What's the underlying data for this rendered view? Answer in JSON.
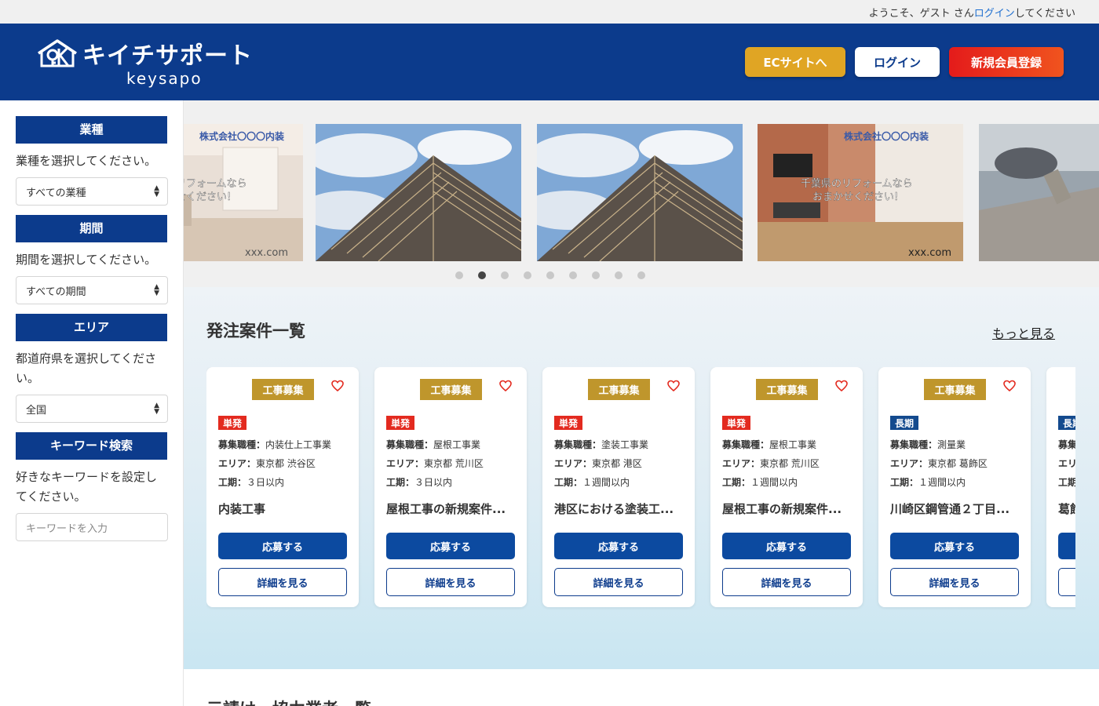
{
  "topbar": {
    "welcome_prefix": "ようこそ、ゲスト さん",
    "login_link": "ログイン",
    "welcome_suffix": "してください"
  },
  "header": {
    "logo_text": "キイチサポート",
    "logo_sub": "keysapo",
    "ec_button": "ECサイトへ",
    "login_button": "ログイン",
    "register_button": "新規会員登録"
  },
  "sidebar": {
    "industry_head": "業種",
    "industry_text": "業種を選択してください。",
    "industry_select": "すべての業種",
    "period_head": "期間",
    "period_text": "期間を選択してください。",
    "period_select": "すべての期間",
    "area_head": "エリア",
    "area_text": "都道府県を選択してください。",
    "area_select": "全国",
    "keyword_head": "キーワード検索",
    "keyword_text": "好きなキーワードを設定してください。",
    "keyword_placeholder": "キーワードを入力"
  },
  "carousel": {
    "banner_company": "株式会社〇〇〇内装",
    "banner_left_line1": "リフォームなら",
    "banner_left_line2": "せください!",
    "banner_line1": "千葉県のリフォームなら",
    "banner_line2": "おまかせください!",
    "banner_url": "xxx.com",
    "active_index": 1,
    "dot_count": 9
  },
  "section": {
    "title": "発注案件一覧",
    "more_link": "もっと見る",
    "next_title": "元請け・協力業者一覧"
  },
  "labels": {
    "recruit_badge": "工事募集",
    "job_type": "募集職種",
    "area": "エリア",
    "period": "工期",
    "apply": "応募する",
    "detail": "詳細を見る"
  },
  "cards": [
    {
      "tag": "単発",
      "job": "内装仕上工事業",
      "area": "東京都 渋谷区",
      "period": "３日以内",
      "title": "内装工事"
    },
    {
      "tag": "単発",
      "job": "屋根工事業",
      "area": "東京都 荒川区",
      "period": "３日以内",
      "title": "屋根工事の新規案件..."
    },
    {
      "tag": "単発",
      "job": "塗装工事業",
      "area": "東京都 港区",
      "period": "１週間以内",
      "title": "港区における塗装工..."
    },
    {
      "tag": "単発",
      "job": "屋根工事業",
      "area": "東京都 荒川区",
      "period": "１週間以内",
      "title": "屋根工事の新規案件..."
    },
    {
      "tag": "長期",
      "job": "測量業",
      "area": "東京都 葛飾区",
      "period": "１週間以内",
      "title": "川崎区鋼管通２丁目..."
    },
    {
      "tag": "長期",
      "job": "",
      "area": "",
      "period": "",
      "title": "葛飾"
    }
  ],
  "colors": {
    "primary": "#0c3b8c",
    "accent_gold": "#bf962c",
    "accent_red": "#e32a1f",
    "ec_orange": "#e0a524"
  }
}
